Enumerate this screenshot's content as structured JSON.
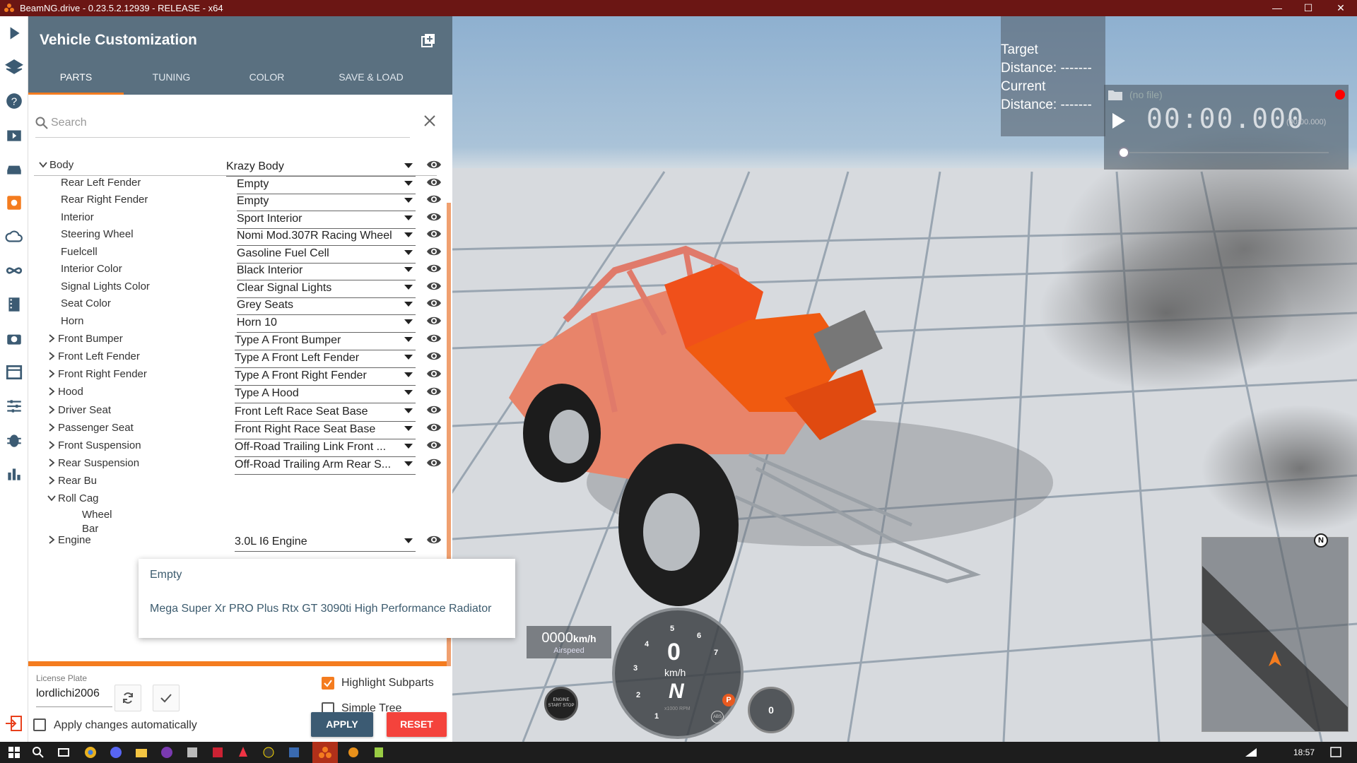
{
  "titlebar": {
    "title": "BeamNG.drive - 0.23.5.2.12939 - RELEASE - x64",
    "minimize": "—",
    "maximize": "☐",
    "close": "✕"
  },
  "panel": {
    "title": "Vehicle Customization",
    "tabs": [
      "PARTS",
      "TUNING",
      "COLOR",
      "SAVE & LOAD"
    ],
    "active_tab": "PARTS",
    "search_placeholder": "Search"
  },
  "parts": [
    {
      "label": "Body",
      "value": "Krazy Body",
      "level": 0,
      "expander": "open"
    },
    {
      "label": "Rear Left Fender",
      "value": "Empty",
      "level": 1,
      "expander": "none"
    },
    {
      "label": "Rear Right Fender",
      "value": "Empty",
      "level": 1,
      "expander": "none"
    },
    {
      "label": "Interior",
      "value": "Sport Interior",
      "level": 1,
      "expander": "none"
    },
    {
      "label": "Steering Wheel",
      "value": "Nomi Mod.307R Racing Wheel",
      "level": 1,
      "expander": "none"
    },
    {
      "label": "Fuelcell",
      "value": "Gasoline Fuel Cell",
      "level": 1,
      "expander": "none"
    },
    {
      "label": "Interior Color",
      "value": "Black Interior",
      "level": 1,
      "expander": "none"
    },
    {
      "label": "Signal Lights Color",
      "value": "Clear Signal Lights",
      "level": 1,
      "expander": "none"
    },
    {
      "label": "Seat Color",
      "value": "Grey Seats",
      "level": 1,
      "expander": "none"
    },
    {
      "label": "Horn",
      "value": "Horn 10",
      "level": 1,
      "expander": "none"
    },
    {
      "label": "Front Bumper",
      "value": "Type A Front Bumper",
      "level": 1,
      "expander": "closed"
    },
    {
      "label": "Front Left Fender",
      "value": "Type A Front Left Fender",
      "level": 1,
      "expander": "closed"
    },
    {
      "label": "Front Right Fender",
      "value": "Type A Front Right Fender",
      "level": 1,
      "expander": "closed"
    },
    {
      "label": "Hood",
      "value": "Type A Hood",
      "level": 1,
      "expander": "closed"
    },
    {
      "label": "Driver Seat",
      "value": "Front Left Race Seat Base",
      "level": 1,
      "expander": "closed"
    },
    {
      "label": "Passenger Seat",
      "value": "Front Right Race Seat Base",
      "level": 1,
      "expander": "closed"
    },
    {
      "label": "Front Suspension",
      "value": "Off-Road Trailing Link Front ...",
      "level": 1,
      "expander": "closed"
    },
    {
      "label": "Rear Suspension",
      "value": "Off-Road Trailing Arm Rear S...",
      "level": 1,
      "expander": "closed"
    },
    {
      "label": "Rear Bu",
      "value": "",
      "level": 1,
      "expander": "closed"
    },
    {
      "label": "Roll Cag",
      "value": "",
      "level": 1,
      "expander": "open"
    },
    {
      "label": "Wheel",
      "value": "",
      "level": 2,
      "expander": "none",
      "label2": "Bar"
    },
    {
      "label": "Engine",
      "value": "3.0L I6 Engine",
      "level": 1,
      "expander": "closed"
    }
  ],
  "dropdown_options": [
    "Empty",
    "Mega Super Xr PRO Plus Rtx GT 3090ti High Performance Radiator"
  ],
  "footer": {
    "plate_label": "License Plate",
    "plate_value": "lordlichi2006",
    "highlight_label": "Highlight Subparts",
    "highlight_checked": true,
    "simple_tree_label": "Simple Tree",
    "simple_tree_checked": false,
    "apply_auto_label": "Apply changes automatically",
    "apply_auto_checked": false,
    "apply_label": "APPLY",
    "reset_label": "RESET"
  },
  "hud": {
    "target_lines": [
      "Target",
      "Distance: -------",
      "Current",
      "Distance: -------"
    ],
    "replay_file": "(no file)",
    "replay_timer": "00:00.000",
    "replay_total": "(00:00.000)",
    "airspeed_value": "0000",
    "airspeed_unit": "km/h",
    "airspeed_label": "Airspeed",
    "gear": "N",
    "speed_value": "0",
    "speed_unit": "km/h",
    "rpm_label": "x1000 RPM",
    "gauge_ticks": [
      "1",
      "2",
      "3",
      "4",
      "5",
      "6",
      "7"
    ],
    "engine_button": "ENGINE START STOP",
    "side_gauge_value": "0",
    "park_badge": "P",
    "abs_badge": "ABS",
    "compass": "N"
  },
  "taskbar": {
    "time": "18:57"
  },
  "colors": {
    "accent": "#f47c1f",
    "header": "#5a7080",
    "titlebar": "#6b1614",
    "apply": "#3c5b73",
    "reset": "#f4433c"
  }
}
